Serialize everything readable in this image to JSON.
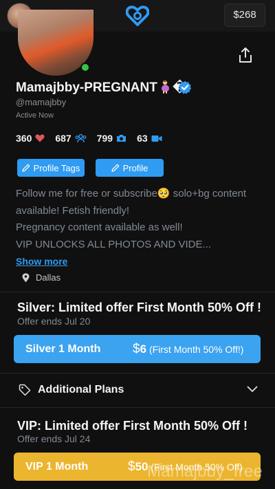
{
  "header": {
    "balance": "$268",
    "logo_icon": "heart-lock-logo-icon",
    "brand_color": "#2f9bf3"
  },
  "profile": {
    "name": "Mamajbby-PREGNANT",
    "name_extra": "�",
    "handle": "@mamajbby",
    "status": "Active Now",
    "stats": {
      "likes": "360",
      "fans": "687",
      "photos": "799",
      "videos": "63"
    },
    "buttons": {
      "profile_tags": "Profile Tags",
      "profile": "Profile"
    },
    "bio_lines": [
      "Follow me for free or subscribe🥺 solo+bg content",
      "available! Fetish friendly!",
      "Pregnancy content available as well!",
      "VIP UNLOCKS ALL PHOTOS AND VIDE..."
    ],
    "show_more": "Show more",
    "location": "Dallas"
  },
  "offers": {
    "silver": {
      "title": "Silver: Limited offer First Month 50% Off !",
      "ends": "Offer ends Jul 20",
      "plan_name": "Silver 1 Month",
      "dollar": "$",
      "price": "6",
      "discount": "(First Month 50% Off!)",
      "color": "#3ba3f0"
    },
    "additional": {
      "label": "Additional Plans"
    },
    "vip": {
      "title": "VIP: Limited offer First Month 50% Off !",
      "ends": "Offer ends Jul 24",
      "plan_name": "VIP 1 Month",
      "dollar": "$",
      "price": "50",
      "discount": "(First Month 50% Off)",
      "color": "#ecb52f"
    }
  },
  "watermark": "Mamajbby_free"
}
